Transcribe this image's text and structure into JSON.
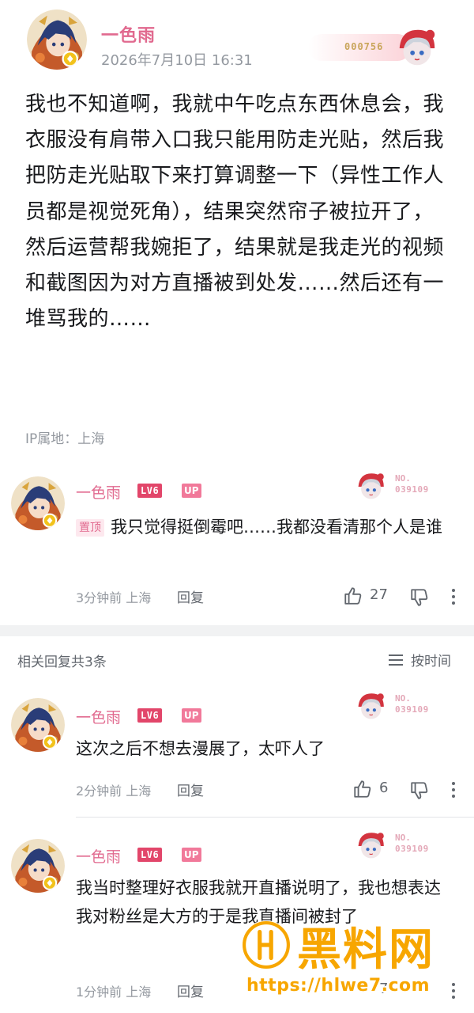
{
  "post": {
    "author": "一色雨",
    "timestamp": "2026年7月10日 16:31",
    "fan_badge_number": "000756",
    "body": "我也不知道啊，我就中午吃点东西休息会，我衣服没有肩带入口我只能用防走光贴，然后我把防走光贴取下来打算调整一下（异性工作人员都是视觉死角），结果突然帘子被拉开了，然后运营帮我婉拒了，结果就是我走光的视频和截图因为对方直播被到处发……然后还有一堆骂我的……",
    "ip_location": "IP属地：上海"
  },
  "pinned_comment": {
    "author": "一色雨",
    "level": "LV6",
    "up_tag": "UP",
    "no_label": "NO.",
    "no_number": "039109",
    "pin_label": "置顶",
    "text": "我只觉得挺倒霉吧……我都没看清那个人是谁",
    "time": "3分钟前",
    "location": "上海",
    "reply_label": "回复",
    "likes": "27"
  },
  "replies_header": {
    "title": "相关回复共3条",
    "sort_label": "按时间"
  },
  "replies": [
    {
      "author": "一色雨",
      "level": "LV6",
      "up_tag": "UP",
      "no_label": "NO.",
      "no_number": "039109",
      "text": "这次之后不想去漫展了，太吓人了",
      "time": "2分钟前",
      "location": "上海",
      "reply_label": "回复",
      "likes": "6"
    },
    {
      "author": "一色雨",
      "level": "LV6",
      "up_tag": "UP",
      "no_label": "NO.",
      "no_number": "039109",
      "text": "我当时整理好衣服我就开直播说明了，我也想表达我对粉丝是大方的于是我直播间被封了",
      "time": "1分钟前",
      "location": "上海",
      "reply_label": "回复",
      "likes": "7"
    }
  ],
  "watermark": {
    "brand": "黑料网",
    "url": "https://hlwe7.com"
  },
  "colors": {
    "username_pink": "#e16a8f",
    "level_badge": "#e2466a",
    "meta_gray": "#9499a0",
    "watermark_orange": "#f7a600"
  },
  "icons": [
    "avatar-illustration",
    "fan-badge-chibi",
    "like-icon",
    "dislike-icon",
    "more-icon",
    "sort-icon",
    "watermark-logo"
  ]
}
